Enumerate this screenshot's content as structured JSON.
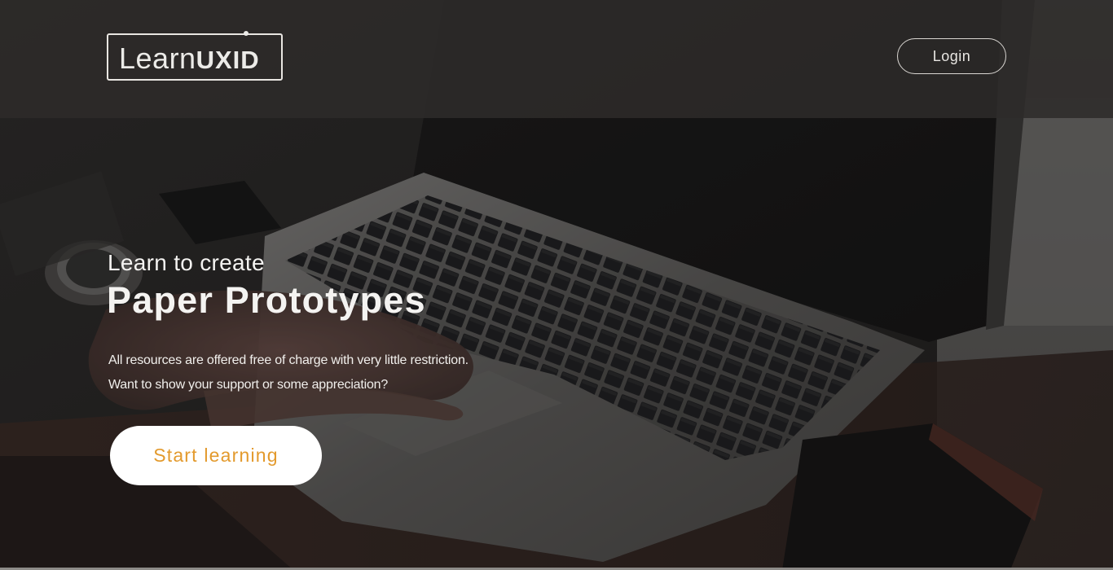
{
  "header": {
    "logo_light": "Learn",
    "logo_bold": "UXID",
    "login_label": "Login"
  },
  "hero": {
    "kicker": "Learn to create",
    "title": "Paper Prototypes",
    "paragraph_line_1": "All resources are offered free of charge with very little restriction.",
    "paragraph_line_2": "Want to show your support or some appreciation?",
    "cta_label": "Start learning"
  },
  "colors": {
    "cta_text": "#e39a2d",
    "cta_background": "#ffffff",
    "header_overlay": "#2d2b2a"
  },
  "icons": {
    "background": "laptop-keyboard-hands-photo"
  }
}
